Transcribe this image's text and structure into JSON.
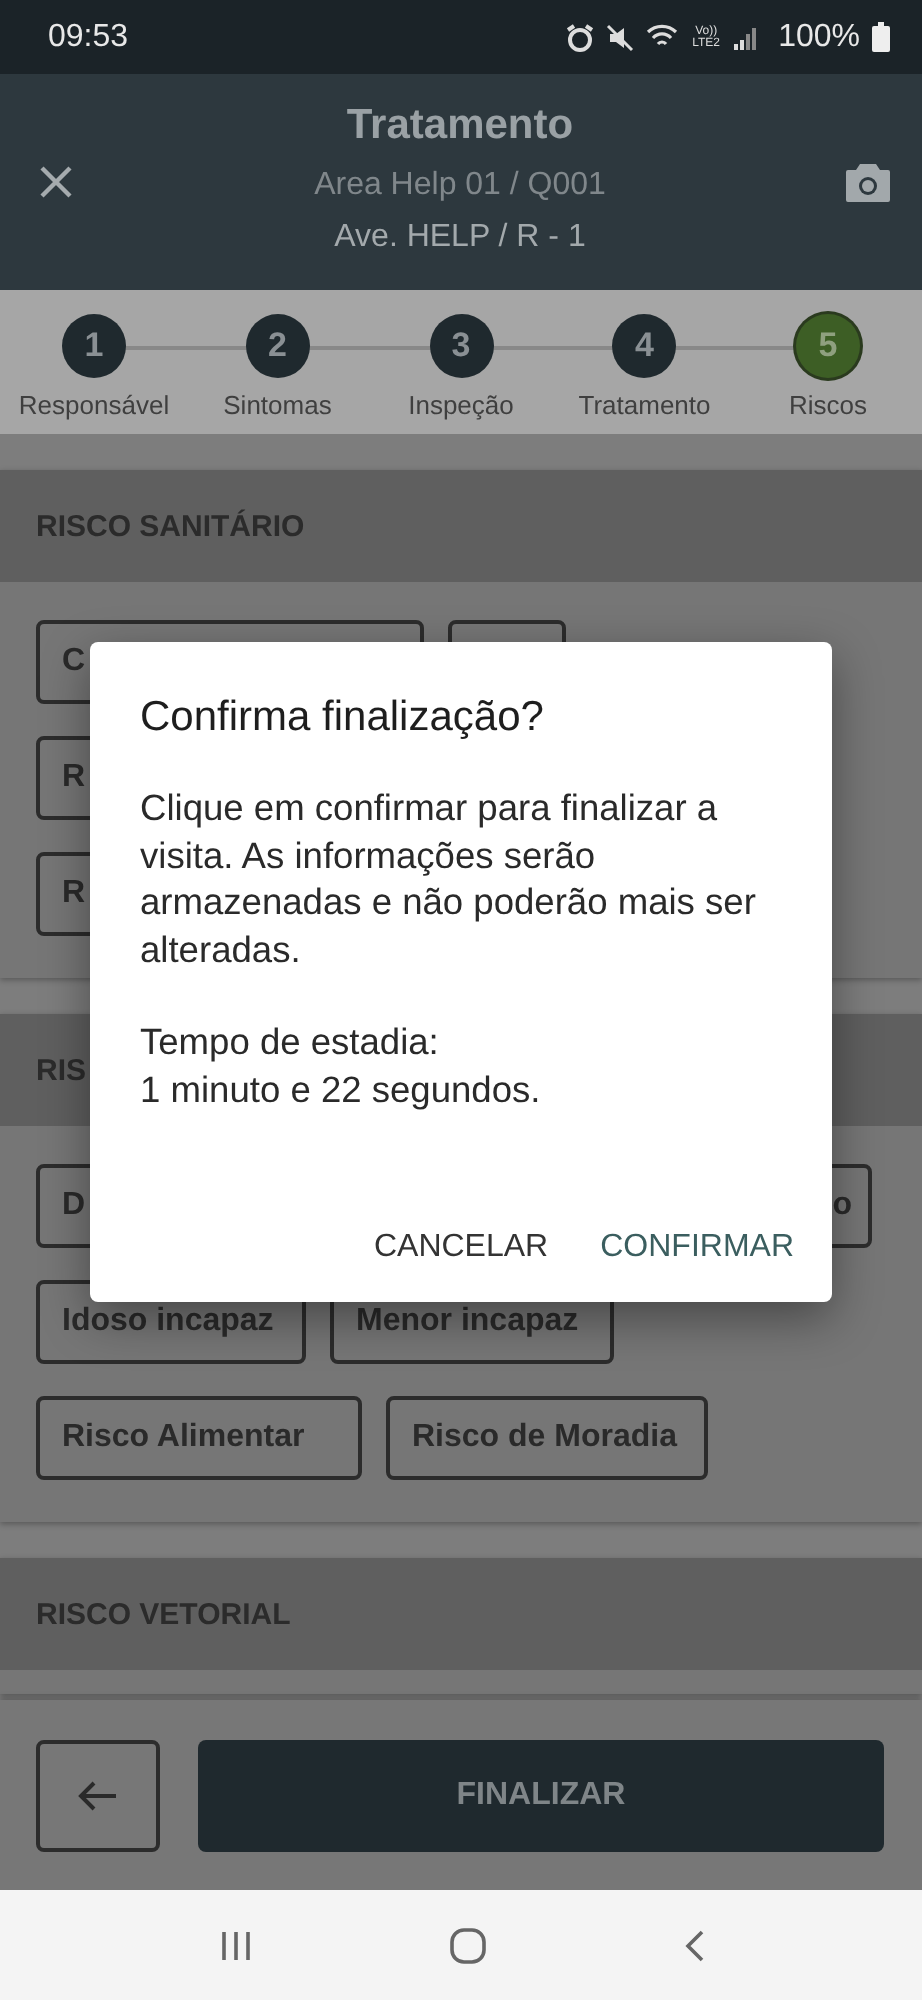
{
  "status_bar": {
    "time": "09:53",
    "network": "Vo)) LTE2",
    "battery": "100%"
  },
  "header": {
    "title": "Tratamento",
    "subtitle_lines": [
      "Area Help 01 / Q001",
      "Ave. HELP / R - 1"
    ]
  },
  "steps": [
    {
      "number": "1",
      "label": "Responsável",
      "selected": false
    },
    {
      "number": "2",
      "label": "Sintomas",
      "selected": false
    },
    {
      "number": "3",
      "label": "Inspeção",
      "selected": false
    },
    {
      "number": "4",
      "label": "Tratamento",
      "selected": false
    },
    {
      "number": "5",
      "label": "Riscos",
      "selected": true
    }
  ],
  "sections": [
    {
      "title": "RISCO SANITÁRIO",
      "chip_rows": [
        [
          {
            "label": "C"
          },
          {}
        ],
        [
          {
            "label": "R"
          }
        ],
        [
          {
            "label": "R"
          }
        ]
      ]
    },
    {
      "title": "RIS",
      "chip_rows": [
        [
          {
            "label": "D"
          },
          {
            "label": "o"
          }
        ],
        [
          {
            "label": "Idoso incapaz"
          },
          {
            "label": "Menor incapaz"
          }
        ],
        [
          {
            "label": "Risco Alimentar"
          },
          {
            "label": "Risco de Moradia"
          }
        ]
      ]
    },
    {
      "title": "RISCO VETORIAL"
    }
  ],
  "bottom_bar": {
    "primary_button": "FINALIZAR"
  },
  "dialog": {
    "title": "Confirma finalização?",
    "paragraphs": [
      "Clique em confirmar para finalizar a visita. As informações serão armazenadas e não poderão mais ser alteradas.",
      "Tempo de estadia:\n1 minuto e 22 segundos."
    ],
    "buttons": [
      {
        "label": "CANCELAR",
        "kind": "neutral"
      },
      {
        "label": "CONFIRMAR",
        "kind": "primary"
      }
    ]
  }
}
